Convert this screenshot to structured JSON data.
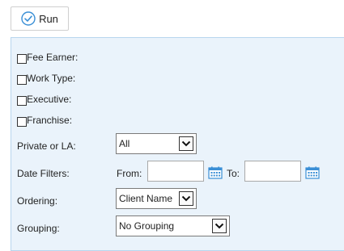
{
  "toolbar": {
    "run_label": "Run"
  },
  "filters": {
    "checkboxes": [
      {
        "label": "Fee Earner:",
        "checked": false
      },
      {
        "label": "Work Type:",
        "checked": false
      },
      {
        "label": "Executive:",
        "checked": false
      },
      {
        "label": "Franchise:",
        "checked": false
      }
    ],
    "private_or_la": {
      "label": "Private or LA:",
      "value": "All"
    },
    "date_filters": {
      "label": "Date Filters:",
      "from_label": "From:",
      "from_value": "",
      "to_label": "To:",
      "to_value": ""
    },
    "ordering": {
      "label": "Ordering:",
      "value": "Client Name"
    },
    "grouping": {
      "label": "Grouping:",
      "value": "No Grouping"
    }
  },
  "colors": {
    "panel_bg": "#eaf3fb",
    "panel_border": "#b8d6ee",
    "accent": "#3a8fd6"
  },
  "icons": {
    "run": "check-circle-icon",
    "calendar": "calendar-icon",
    "dropdown": "chevron-down-icon"
  }
}
